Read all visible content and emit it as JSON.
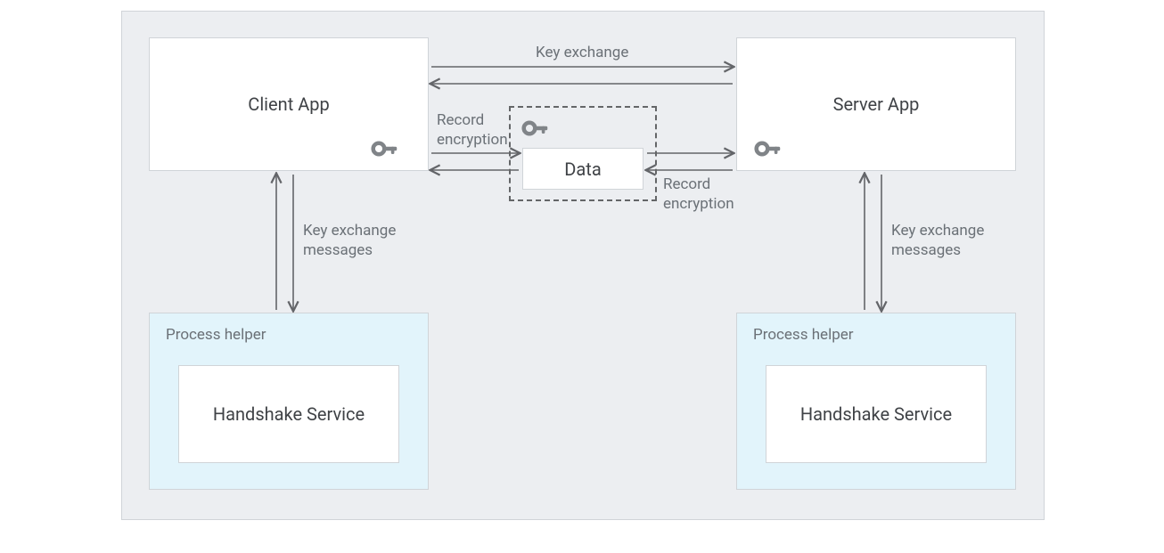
{
  "boxes": {
    "client_app": "Client App",
    "server_app": "Server App",
    "data": "Data",
    "handshake_service": "Handshake Service"
  },
  "labels": {
    "process_helper": "Process helper",
    "key_exchange": "Key exchange",
    "record_encryption": "Record encryption",
    "key_exchange_messages": "Key exchange messages"
  },
  "colors": {
    "bg": "#eceef1",
    "border": "#d0d4d8",
    "helper_bg": "#e2f4fb",
    "text": "#3f4246",
    "label": "#6b7177",
    "arrow": "#636569"
  }
}
